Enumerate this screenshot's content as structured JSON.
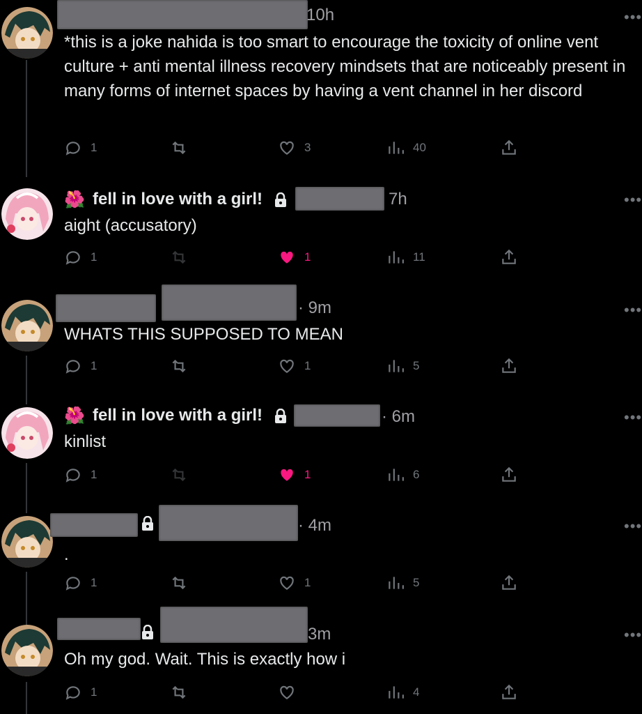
{
  "posts": [
    {
      "handle_name": "",
      "time": "10h",
      "body": "*this is a joke nahida is too smart to encourage the toxicity of online vent culture + anti mental illness recovery mindsets that are noticeably present in many forms of internet spaces by having a vent channel in her discord",
      "replies": "1",
      "reposts": "",
      "likes": "3",
      "liked": false,
      "views": "40"
    },
    {
      "handle_name": "fell in love with a girl!",
      "flower": "🌺",
      "time": "7h",
      "body": "aight (accusatory)",
      "replies": "1",
      "reposts": "",
      "likes": "1",
      "liked": true,
      "views": "11"
    },
    {
      "handle_name": "",
      "time": "· 9m",
      "body": "WHATS THIS SUPPOSED TO MEAN",
      "replies": "1",
      "reposts": "",
      "likes": "1",
      "liked": false,
      "views": "5"
    },
    {
      "handle_name": "fell in love with a girl!",
      "flower": "🌺",
      "time": "· 6m",
      "body": "kinlist",
      "replies": "1",
      "reposts": "",
      "likes": "1",
      "liked": true,
      "views": "6"
    },
    {
      "handle_name": "",
      "time": "· 4m",
      "body": ".",
      "replies": "1",
      "reposts": "",
      "likes": "1",
      "liked": false,
      "views": "5"
    },
    {
      "handle_name": "",
      "time": "3m",
      "body": "Oh my god. Wait. This is exactly how i",
      "replies": "1",
      "reposts": "",
      "likes": "",
      "liked": false,
      "views": "4"
    }
  ],
  "more_label": "•••",
  "colors": {
    "like_active": "#f91880",
    "icon_gray": "#71767b",
    "redaction": "#6e6e72"
  }
}
